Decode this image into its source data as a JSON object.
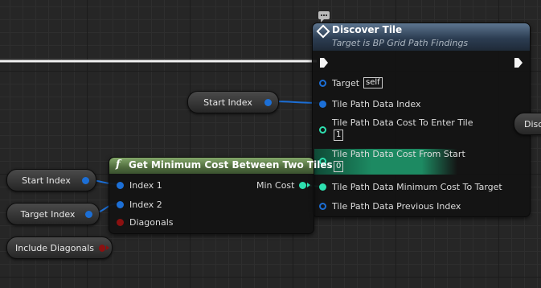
{
  "discover_node": {
    "title": "Discover Tile",
    "subtitle": "Target is BP Grid Path Findings",
    "pins": {
      "target": "Target",
      "target_value": "self",
      "tile_path_data_index": "Tile Path Data Index",
      "cost_to_enter": "Tile Path Data Cost To Enter Tile",
      "cost_to_enter_value": "1",
      "cost_from_start": "Tile Path Data Cost From Start",
      "cost_from_start_value": "0",
      "minimum_cost": "Tile Path Data Minimum Cost To Target",
      "previous_index": "Tile Path Data Previous Index"
    }
  },
  "min_cost_node": {
    "title": "Get Minimum Cost Between Two Tiles",
    "function_glyph": "f",
    "pins": {
      "index1": "Index 1",
      "index2": "Index 2",
      "diagonals": "Diagonals",
      "min_cost": "Min Cost"
    }
  },
  "variables": {
    "start_index_top": "Start Index",
    "start_index_left": "Start Index",
    "target_index": "Target Index",
    "include_diagonals": "Include Diagonals"
  },
  "partial_node": {
    "label": "Disco"
  },
  "colors": {
    "integer_pin": "#1c6fd6",
    "float_pin": "#2ee0b0",
    "bool_pin": "#8b1010",
    "exec_wire": "#ffffff",
    "discover_header": "#3a4f68",
    "function_header": "#5e7a4a"
  },
  "icons": {
    "comment": "comment-bubble-icon",
    "discover": "diamond-icon",
    "function": "function-icon",
    "exec": "exec-arrow-icon"
  }
}
